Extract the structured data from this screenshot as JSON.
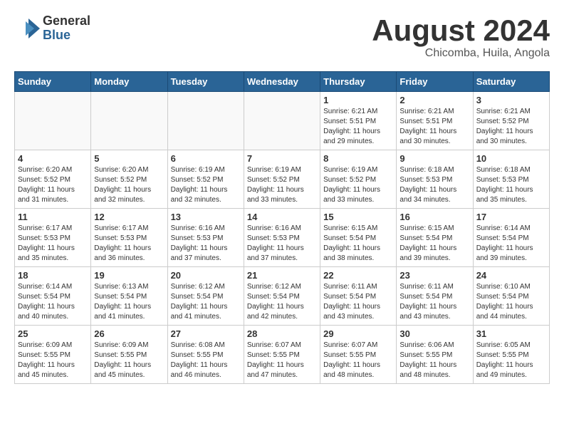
{
  "header": {
    "logo_general": "General",
    "logo_blue": "Blue",
    "month_title": "August 2024",
    "location": "Chicomba, Huila, Angola"
  },
  "weekdays": [
    "Sunday",
    "Monday",
    "Tuesday",
    "Wednesday",
    "Thursday",
    "Friday",
    "Saturday"
  ],
  "weeks": [
    [
      {
        "day": "",
        "info": ""
      },
      {
        "day": "",
        "info": ""
      },
      {
        "day": "",
        "info": ""
      },
      {
        "day": "",
        "info": ""
      },
      {
        "day": "1",
        "info": "Sunrise: 6:21 AM\nSunset: 5:51 PM\nDaylight: 11 hours\nand 29 minutes."
      },
      {
        "day": "2",
        "info": "Sunrise: 6:21 AM\nSunset: 5:51 PM\nDaylight: 11 hours\nand 30 minutes."
      },
      {
        "day": "3",
        "info": "Sunrise: 6:21 AM\nSunset: 5:52 PM\nDaylight: 11 hours\nand 30 minutes."
      }
    ],
    [
      {
        "day": "4",
        "info": "Sunrise: 6:20 AM\nSunset: 5:52 PM\nDaylight: 11 hours\nand 31 minutes."
      },
      {
        "day": "5",
        "info": "Sunrise: 6:20 AM\nSunset: 5:52 PM\nDaylight: 11 hours\nand 32 minutes."
      },
      {
        "day": "6",
        "info": "Sunrise: 6:19 AM\nSunset: 5:52 PM\nDaylight: 11 hours\nand 32 minutes."
      },
      {
        "day": "7",
        "info": "Sunrise: 6:19 AM\nSunset: 5:52 PM\nDaylight: 11 hours\nand 33 minutes."
      },
      {
        "day": "8",
        "info": "Sunrise: 6:19 AM\nSunset: 5:52 PM\nDaylight: 11 hours\nand 33 minutes."
      },
      {
        "day": "9",
        "info": "Sunrise: 6:18 AM\nSunset: 5:53 PM\nDaylight: 11 hours\nand 34 minutes."
      },
      {
        "day": "10",
        "info": "Sunrise: 6:18 AM\nSunset: 5:53 PM\nDaylight: 11 hours\nand 35 minutes."
      }
    ],
    [
      {
        "day": "11",
        "info": "Sunrise: 6:17 AM\nSunset: 5:53 PM\nDaylight: 11 hours\nand 35 minutes."
      },
      {
        "day": "12",
        "info": "Sunrise: 6:17 AM\nSunset: 5:53 PM\nDaylight: 11 hours\nand 36 minutes."
      },
      {
        "day": "13",
        "info": "Sunrise: 6:16 AM\nSunset: 5:53 PM\nDaylight: 11 hours\nand 37 minutes."
      },
      {
        "day": "14",
        "info": "Sunrise: 6:16 AM\nSunset: 5:53 PM\nDaylight: 11 hours\nand 37 minutes."
      },
      {
        "day": "15",
        "info": "Sunrise: 6:15 AM\nSunset: 5:54 PM\nDaylight: 11 hours\nand 38 minutes."
      },
      {
        "day": "16",
        "info": "Sunrise: 6:15 AM\nSunset: 5:54 PM\nDaylight: 11 hours\nand 39 minutes."
      },
      {
        "day": "17",
        "info": "Sunrise: 6:14 AM\nSunset: 5:54 PM\nDaylight: 11 hours\nand 39 minutes."
      }
    ],
    [
      {
        "day": "18",
        "info": "Sunrise: 6:14 AM\nSunset: 5:54 PM\nDaylight: 11 hours\nand 40 minutes."
      },
      {
        "day": "19",
        "info": "Sunrise: 6:13 AM\nSunset: 5:54 PM\nDaylight: 11 hours\nand 41 minutes."
      },
      {
        "day": "20",
        "info": "Sunrise: 6:12 AM\nSunset: 5:54 PM\nDaylight: 11 hours\nand 41 minutes."
      },
      {
        "day": "21",
        "info": "Sunrise: 6:12 AM\nSunset: 5:54 PM\nDaylight: 11 hours\nand 42 minutes."
      },
      {
        "day": "22",
        "info": "Sunrise: 6:11 AM\nSunset: 5:54 PM\nDaylight: 11 hours\nand 43 minutes."
      },
      {
        "day": "23",
        "info": "Sunrise: 6:11 AM\nSunset: 5:54 PM\nDaylight: 11 hours\nand 43 minutes."
      },
      {
        "day": "24",
        "info": "Sunrise: 6:10 AM\nSunset: 5:54 PM\nDaylight: 11 hours\nand 44 minutes."
      }
    ],
    [
      {
        "day": "25",
        "info": "Sunrise: 6:09 AM\nSunset: 5:55 PM\nDaylight: 11 hours\nand 45 minutes."
      },
      {
        "day": "26",
        "info": "Sunrise: 6:09 AM\nSunset: 5:55 PM\nDaylight: 11 hours\nand 45 minutes."
      },
      {
        "day": "27",
        "info": "Sunrise: 6:08 AM\nSunset: 5:55 PM\nDaylight: 11 hours\nand 46 minutes."
      },
      {
        "day": "28",
        "info": "Sunrise: 6:07 AM\nSunset: 5:55 PM\nDaylight: 11 hours\nand 47 minutes."
      },
      {
        "day": "29",
        "info": "Sunrise: 6:07 AM\nSunset: 5:55 PM\nDaylight: 11 hours\nand 48 minutes."
      },
      {
        "day": "30",
        "info": "Sunrise: 6:06 AM\nSunset: 5:55 PM\nDaylight: 11 hours\nand 48 minutes."
      },
      {
        "day": "31",
        "info": "Sunrise: 6:05 AM\nSunset: 5:55 PM\nDaylight: 11 hours\nand 49 minutes."
      }
    ]
  ]
}
